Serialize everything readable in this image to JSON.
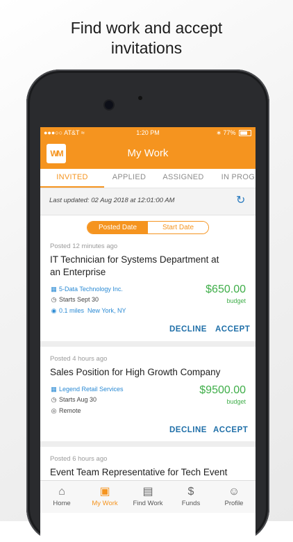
{
  "headline": [
    "Find work and accept",
    "invitations"
  ],
  "status": {
    "carrier": "●●●○○ AT&T",
    "time": "1:20 PM",
    "battery": "77%"
  },
  "app": {
    "logo": "WM",
    "title": "My Work"
  },
  "tabs": [
    "INVITED",
    "APPLIED",
    "ASSIGNED",
    "IN PROGR"
  ],
  "updated": {
    "text": "Last updated: 02 Aug 2018 at 12:01:00 AM",
    "refresh_icon": "refresh-icon"
  },
  "sort": {
    "options": [
      "Posted Date",
      "Start Date"
    ],
    "selected": "Posted Date"
  },
  "jobs": [
    {
      "posted": "Posted 12 minutes ago",
      "title": "IT Technician for Systems Department at an Enterprise",
      "company": "5-Data Technology Inc.",
      "starts": "Starts Sept 30",
      "distance": "0.1 miles",
      "location": "New York, NY",
      "price": "$650.00",
      "price_label": "budget",
      "decline": "DECLINE",
      "accept": "ACCEPT"
    },
    {
      "posted": "Posted 4 hours ago",
      "title": "Sales Position for High Growth Company",
      "company": "Legend Retail Services",
      "starts": "Starts Aug 30",
      "location": "Remote",
      "price": "$9500.00",
      "price_label": "budget",
      "decline": "DECLINE",
      "accept": "ACCEPT"
    },
    {
      "posted": "Posted 6 hours ago",
      "title": "Event Team Representative for Tech Event"
    }
  ],
  "nav": [
    {
      "label": "Home",
      "icon": "home-icon"
    },
    {
      "label": "My Work",
      "icon": "briefcase-icon"
    },
    {
      "label": "Find Work",
      "icon": "find-work-icon"
    },
    {
      "label": "Funds",
      "icon": "dollar-icon"
    },
    {
      "label": "Profile",
      "icon": "profile-icon"
    }
  ],
  "colors": {
    "accent": "#f5941f",
    "price": "#3fae49",
    "link": "#2a8ad4"
  }
}
